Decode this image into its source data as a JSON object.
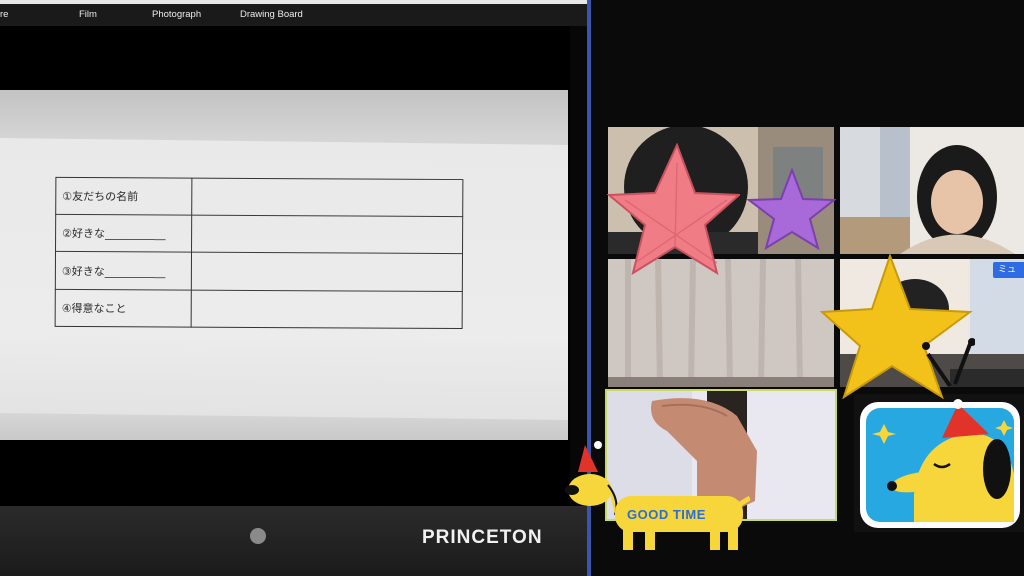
{
  "menu": {
    "items": [
      "re",
      "Film",
      "Photograph",
      "Drawing Board"
    ]
  },
  "worksheet": {
    "rows": [
      "①友だちの名前",
      "②好きな___________",
      "③好きな___________",
      "④得意なこと"
    ]
  },
  "device": {
    "brand": "PRINCETON"
  },
  "gallery": {
    "mute_badge": "ミュ"
  },
  "stickers": {
    "dog_text": "GOOD TIME"
  },
  "colors": {
    "divider": "#3a56a8",
    "accent_blue": "#2f6be3",
    "tv_bg": "#28a8e0",
    "dog_yellow": "#f6d63a",
    "hat_red": "#e2332a"
  },
  "icons": [
    "record-dot-icon",
    "pink-star-icon",
    "purple-star-icon",
    "gold-star-icon",
    "dog-sticker-icon",
    "tv-dog-sticker-icon"
  ]
}
